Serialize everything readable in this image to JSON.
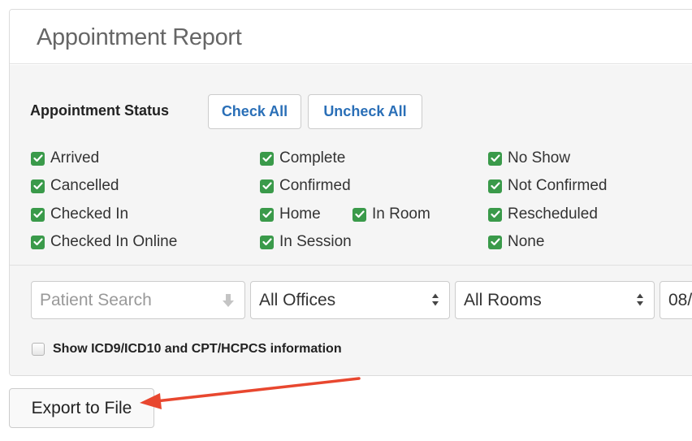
{
  "panel": {
    "title": "Appointment Report"
  },
  "status": {
    "label": "Appointment Status",
    "check_all": "Check All",
    "uncheck_all": "Uncheck All",
    "items": [
      {
        "label": "Arrived",
        "checked": true
      },
      {
        "label": "Cancelled",
        "checked": true
      },
      {
        "label": "Checked In",
        "checked": true
      },
      {
        "label": "Checked In Online",
        "checked": true
      },
      {
        "label": "Complete",
        "checked": true
      },
      {
        "label": "Confirmed",
        "checked": true
      },
      {
        "label": "Home",
        "checked": true
      },
      {
        "label": "In Room",
        "checked": true
      },
      {
        "label": "In Session",
        "checked": true
      },
      {
        "label": "No Show",
        "checked": true
      },
      {
        "label": "Not Confirmed",
        "checked": true
      },
      {
        "label": "Rescheduled",
        "checked": true
      },
      {
        "label": "None",
        "checked": true
      }
    ]
  },
  "filters": {
    "patient_search_placeholder": "Patient Search",
    "offices": "All Offices",
    "rooms": "All Rooms",
    "date_partial": "08/"
  },
  "icd_option": {
    "label": "Show ICD9/ICD10 and CPT/HCPCS information",
    "checked": false
  },
  "export_button": "Export to File",
  "colors": {
    "check_green": "#3a9a4a",
    "link_blue": "#2a6fb7",
    "arrow_red": "#e8472f"
  }
}
